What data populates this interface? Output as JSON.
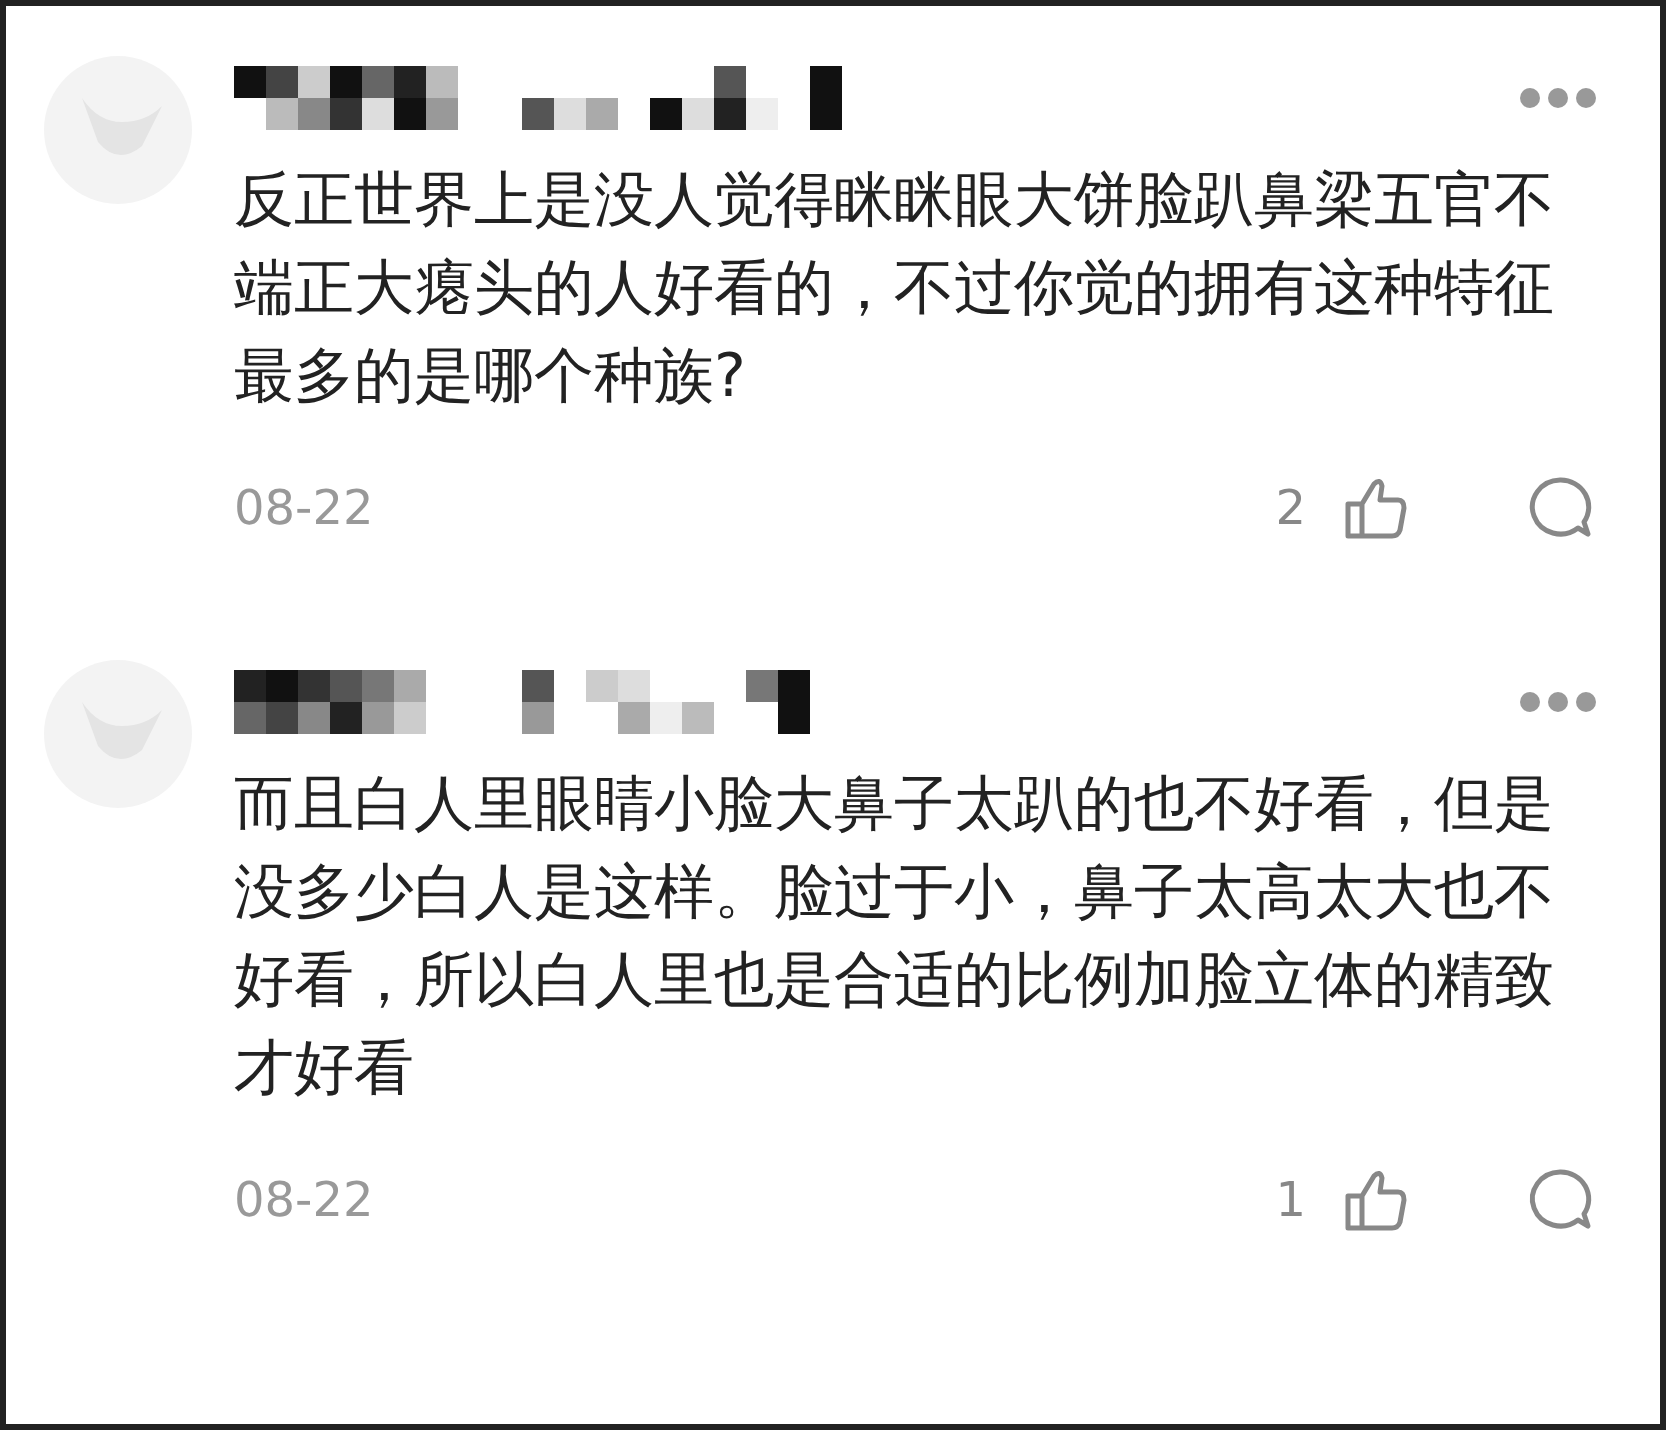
{
  "comments": [
    {
      "text": "反正世界上是没人觉得眯眯眼大饼脸趴鼻梁五官不端正大瘪头的人好看的，不过你觉的拥有这种特征最多的是哪个种族?",
      "date": "08-22",
      "likes": "2"
    },
    {
      "text": "而且白人里眼睛小脸大鼻子太趴的也不好看，但是没多少白人是这样。脸过于小，鼻子太高太大也不好看，所以白人里也是合适的比例加脸立体的精致才好看",
      "date": "08-22",
      "likes": "1"
    }
  ]
}
